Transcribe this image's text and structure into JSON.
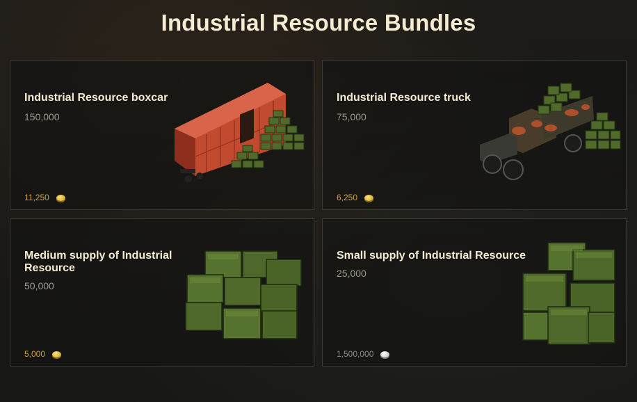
{
  "page": {
    "title": "Industrial Resource Bundles"
  },
  "bundles": [
    {
      "name": "Industrial Resource boxcar",
      "amount": "150,000",
      "price": "11,250",
      "currency": "gold-coin-icon"
    },
    {
      "name": "Industrial Resource truck",
      "amount": "75,000",
      "price": "6,250",
      "currency": "gold-coin-icon"
    },
    {
      "name": "Medium supply of Industrial Resource",
      "amount": "50,000",
      "price": "5,000",
      "currency": "gold-coin-icon"
    },
    {
      "name": "Small supply of Industrial Resource",
      "amount": "25,000",
      "price": "1,500,000",
      "currency": "silver-coin-icon"
    }
  ],
  "colors": {
    "title": "#f5ecd3",
    "gold_price": "#c9a447",
    "silver_price": "#8e8b82",
    "card_border": "#3a3a36",
    "crate_green": "#4f6a2a",
    "boxcar_red": "#c94a2e"
  }
}
